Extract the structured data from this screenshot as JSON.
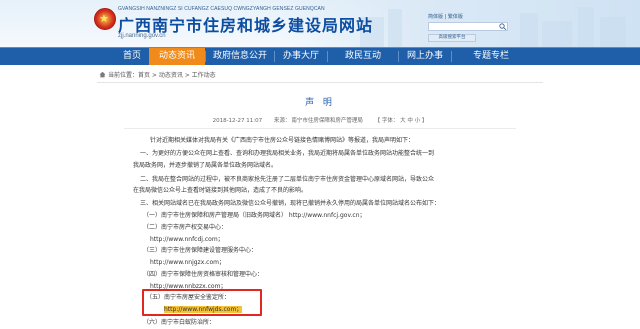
{
  "header": {
    "pinyin_left": "GVANGSIH NANZNINGZ SI CUFANGZ CAESUQ CWNGZYANGH GENSEZ GUENQCAN",
    "title": "广西南宁市住房和城乡建设局网站",
    "pinyin_right": "",
    "domain": "zjj.nanning.gov.cn",
    "lang_links": "简体版 | 繁体版",
    "search_placeholder": "输入关键字搜索",
    "advanced_search": "高级搜索平台"
  },
  "nav": {
    "items": [
      {
        "label": "首页",
        "active": false
      },
      {
        "label": "动态资讯",
        "active": true
      },
      {
        "label": "政府信息公开",
        "active": false
      },
      {
        "label": "办事大厅",
        "active": false
      },
      {
        "label": "政民互动",
        "active": false
      },
      {
        "label": "网上办事",
        "active": false
      },
      {
        "label": "专题专栏",
        "active": false
      }
    ]
  },
  "breadcrumb": {
    "text": "当前位置：首页 > 动态资讯 > 工作动态"
  },
  "article": {
    "title": "声 明",
    "date": "2018-12-27 11:07",
    "source": "来源：",
    "publisher": "南宁市住房保障和房产管理局",
    "font_size": "【 字体：  大  中  小  】",
    "paragraphs": [
      "针对近期相关媒体对我局有关《广西南宁市住房公众号链接色情赌博网站》等报道，我局声明如下：",
      "一、为更好的方便公众在网上查看、查询和办理我局相关业务，我局近期将局属各单位政务网站功能整合统一到",
      "我局政务网，并逐步撤销了局属各单位政务网站域名。",
      "二、我局在整合网站的过程中，被不良商家抢先注册了二层单位南宁市住房资金管理中心原域名网站，导致公众",
      "在我局微信公众号上查看时链接到其他网站，造成了不良的影响。",
      "三、相关网站域名已在我局政务网站及微信公众号撤销，现将已撤销并永久停用的局属各单位网站域名公布如下：",
      "（一）南宁市住房保障和房产管理局（旧政务网域名）  http://www.nnfcj.gov.cn；",
      "（二）南宁市房产权交易中心：",
      "http://www.nnfcdj.com；",
      "（三）南宁市住房保障建设管理服务中心：",
      "http://www.nnjgzx.com；",
      "（四）南宁市保障住房资格审核和管理中心：",
      "http://www.nnbzzx.com；",
      "（五）南宁市房屋安全鉴定所：",
      "http://www.nnfwjds.com；",
      "（六）南宁市白蚁防治所："
    ]
  },
  "colors": {
    "nav_bg": "#1f5ea8",
    "nav_active": "#f08a1a",
    "title_blue": "#0d4da1",
    "highlight_box": "#e0281e",
    "highlight_fill": "#f3c23a"
  },
  "icons": {
    "home": "house-icon",
    "search": "search-icon",
    "emblem": "emblem-icon"
  }
}
